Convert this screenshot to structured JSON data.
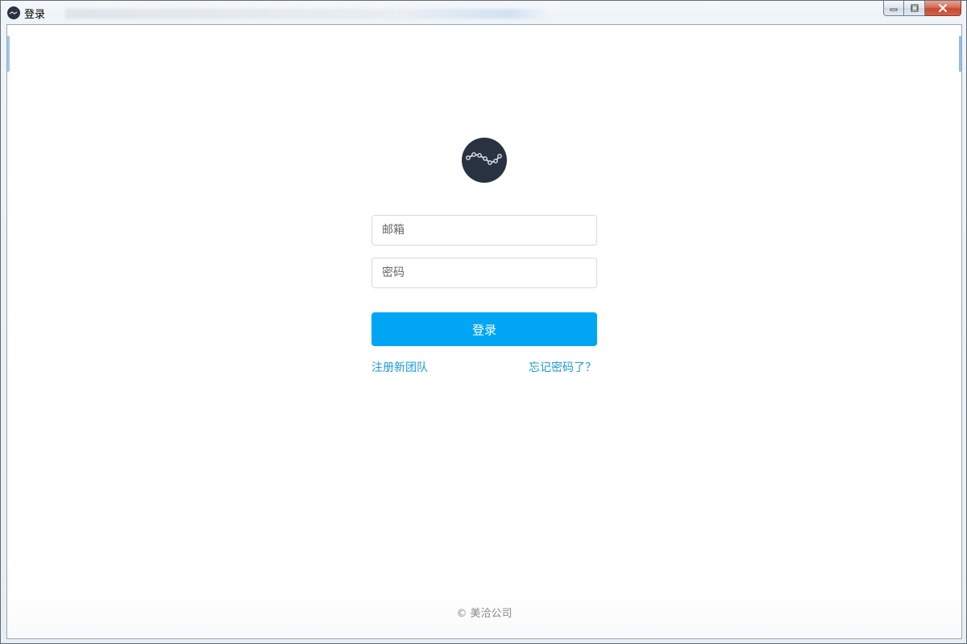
{
  "window": {
    "title": "登录"
  },
  "logo": {
    "icon": "line-chart-icon",
    "background": "#283241"
  },
  "form": {
    "email_placeholder": "邮箱",
    "email_value": "",
    "password_placeholder": "密码",
    "password_value": "",
    "login_label": "登录",
    "accent_color": "#00a6f4"
  },
  "links": {
    "register": "注册新团队",
    "forgot": "忘记密码了？",
    "color": "#1a9ad8"
  },
  "footer": {
    "copyright": "© 美洽公司"
  }
}
